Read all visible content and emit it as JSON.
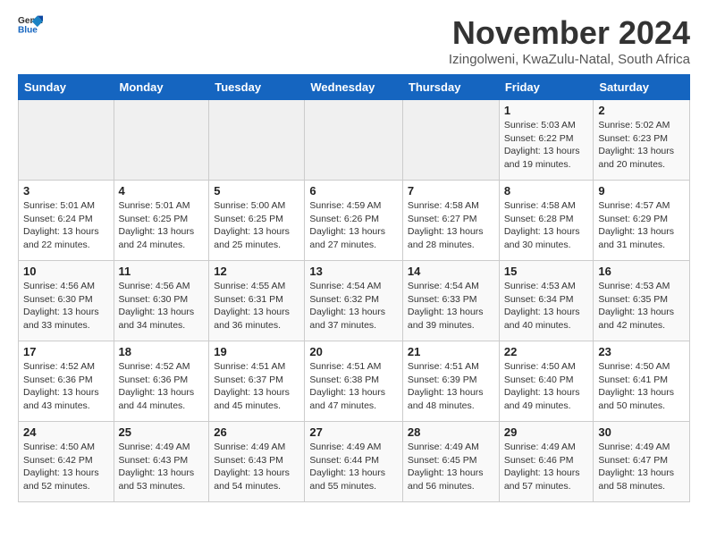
{
  "header": {
    "logo_general": "General",
    "logo_blue": "Blue",
    "month_title": "November 2024",
    "location": "Izingolweni, KwaZulu-Natal, South Africa"
  },
  "days_of_week": [
    "Sunday",
    "Monday",
    "Tuesday",
    "Wednesday",
    "Thursday",
    "Friday",
    "Saturday"
  ],
  "weeks": [
    [
      {
        "day": "",
        "info": ""
      },
      {
        "day": "",
        "info": ""
      },
      {
        "day": "",
        "info": ""
      },
      {
        "day": "",
        "info": ""
      },
      {
        "day": "",
        "info": ""
      },
      {
        "day": "1",
        "info": "Sunrise: 5:03 AM\nSunset: 6:22 PM\nDaylight: 13 hours and 19 minutes."
      },
      {
        "day": "2",
        "info": "Sunrise: 5:02 AM\nSunset: 6:23 PM\nDaylight: 13 hours and 20 minutes."
      }
    ],
    [
      {
        "day": "3",
        "info": "Sunrise: 5:01 AM\nSunset: 6:24 PM\nDaylight: 13 hours and 22 minutes."
      },
      {
        "day": "4",
        "info": "Sunrise: 5:01 AM\nSunset: 6:25 PM\nDaylight: 13 hours and 24 minutes."
      },
      {
        "day": "5",
        "info": "Sunrise: 5:00 AM\nSunset: 6:25 PM\nDaylight: 13 hours and 25 minutes."
      },
      {
        "day": "6",
        "info": "Sunrise: 4:59 AM\nSunset: 6:26 PM\nDaylight: 13 hours and 27 minutes."
      },
      {
        "day": "7",
        "info": "Sunrise: 4:58 AM\nSunset: 6:27 PM\nDaylight: 13 hours and 28 minutes."
      },
      {
        "day": "8",
        "info": "Sunrise: 4:58 AM\nSunset: 6:28 PM\nDaylight: 13 hours and 30 minutes."
      },
      {
        "day": "9",
        "info": "Sunrise: 4:57 AM\nSunset: 6:29 PM\nDaylight: 13 hours and 31 minutes."
      }
    ],
    [
      {
        "day": "10",
        "info": "Sunrise: 4:56 AM\nSunset: 6:30 PM\nDaylight: 13 hours and 33 minutes."
      },
      {
        "day": "11",
        "info": "Sunrise: 4:56 AM\nSunset: 6:30 PM\nDaylight: 13 hours and 34 minutes."
      },
      {
        "day": "12",
        "info": "Sunrise: 4:55 AM\nSunset: 6:31 PM\nDaylight: 13 hours and 36 minutes."
      },
      {
        "day": "13",
        "info": "Sunrise: 4:54 AM\nSunset: 6:32 PM\nDaylight: 13 hours and 37 minutes."
      },
      {
        "day": "14",
        "info": "Sunrise: 4:54 AM\nSunset: 6:33 PM\nDaylight: 13 hours and 39 minutes."
      },
      {
        "day": "15",
        "info": "Sunrise: 4:53 AM\nSunset: 6:34 PM\nDaylight: 13 hours and 40 minutes."
      },
      {
        "day": "16",
        "info": "Sunrise: 4:53 AM\nSunset: 6:35 PM\nDaylight: 13 hours and 42 minutes."
      }
    ],
    [
      {
        "day": "17",
        "info": "Sunrise: 4:52 AM\nSunset: 6:36 PM\nDaylight: 13 hours and 43 minutes."
      },
      {
        "day": "18",
        "info": "Sunrise: 4:52 AM\nSunset: 6:36 PM\nDaylight: 13 hours and 44 minutes."
      },
      {
        "day": "19",
        "info": "Sunrise: 4:51 AM\nSunset: 6:37 PM\nDaylight: 13 hours and 45 minutes."
      },
      {
        "day": "20",
        "info": "Sunrise: 4:51 AM\nSunset: 6:38 PM\nDaylight: 13 hours and 47 minutes."
      },
      {
        "day": "21",
        "info": "Sunrise: 4:51 AM\nSunset: 6:39 PM\nDaylight: 13 hours and 48 minutes."
      },
      {
        "day": "22",
        "info": "Sunrise: 4:50 AM\nSunset: 6:40 PM\nDaylight: 13 hours and 49 minutes."
      },
      {
        "day": "23",
        "info": "Sunrise: 4:50 AM\nSunset: 6:41 PM\nDaylight: 13 hours and 50 minutes."
      }
    ],
    [
      {
        "day": "24",
        "info": "Sunrise: 4:50 AM\nSunset: 6:42 PM\nDaylight: 13 hours and 52 minutes."
      },
      {
        "day": "25",
        "info": "Sunrise: 4:49 AM\nSunset: 6:43 PM\nDaylight: 13 hours and 53 minutes."
      },
      {
        "day": "26",
        "info": "Sunrise: 4:49 AM\nSunset: 6:43 PM\nDaylight: 13 hours and 54 minutes."
      },
      {
        "day": "27",
        "info": "Sunrise: 4:49 AM\nSunset: 6:44 PM\nDaylight: 13 hours and 55 minutes."
      },
      {
        "day": "28",
        "info": "Sunrise: 4:49 AM\nSunset: 6:45 PM\nDaylight: 13 hours and 56 minutes."
      },
      {
        "day": "29",
        "info": "Sunrise: 4:49 AM\nSunset: 6:46 PM\nDaylight: 13 hours and 57 minutes."
      },
      {
        "day": "30",
        "info": "Sunrise: 4:49 AM\nSunset: 6:47 PM\nDaylight: 13 hours and 58 minutes."
      }
    ]
  ]
}
